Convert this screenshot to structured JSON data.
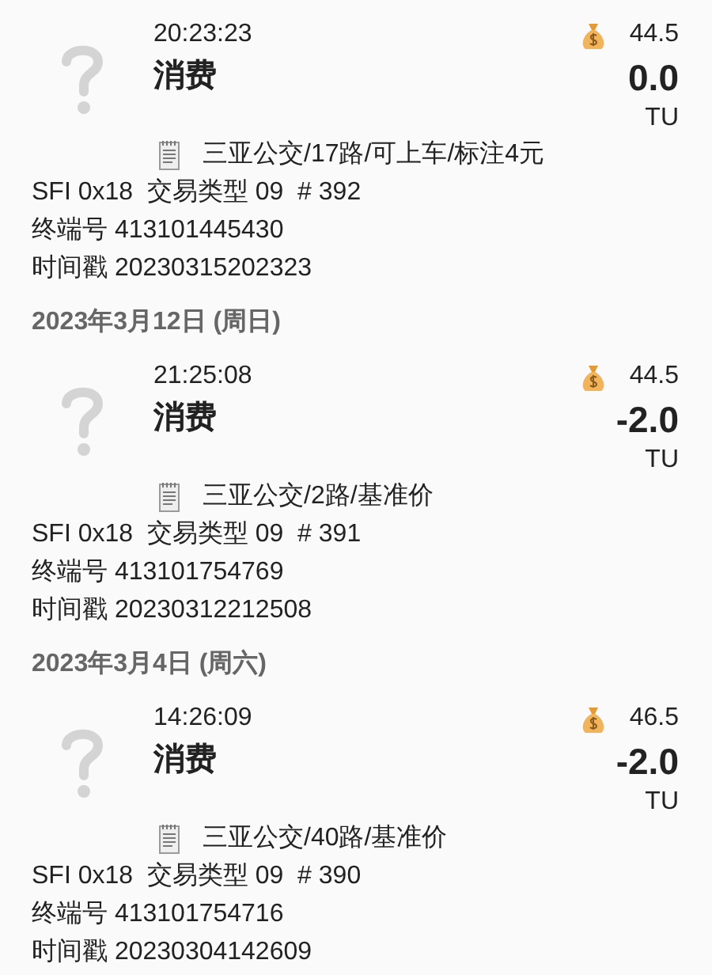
{
  "items": [
    {
      "kind": "transaction",
      "time": "20:23:23",
      "type": "消费",
      "balance": "44.5",
      "amount": "0.0",
      "unit": "TU",
      "memo": "三亚公交/17路/可上车/标注4元",
      "sfi": "SFI 0x18  交易类型 09  # 392",
      "terminal": "终端号 413101445430",
      "timestamp": "时间戳 20230315202323"
    },
    {
      "kind": "header",
      "label": "2023年3月12日 (周日)"
    },
    {
      "kind": "transaction",
      "time": "21:25:08",
      "type": "消费",
      "balance": "44.5",
      "amount": "-2.0",
      "unit": "TU",
      "memo": "三亚公交/2路/基准价",
      "sfi": "SFI 0x18  交易类型 09  # 391",
      "terminal": "终端号 413101754769",
      "timestamp": "时间戳 20230312212508"
    },
    {
      "kind": "header",
      "label": "2023年3月4日 (周六)"
    },
    {
      "kind": "transaction",
      "time": "14:26:09",
      "type": "消费",
      "balance": "46.5",
      "amount": "-2.0",
      "unit": "TU",
      "memo": "三亚公交/40路/基准价",
      "sfi": "SFI 0x18  交易类型 09  # 390",
      "terminal": "终端号 413101754716",
      "timestamp": "时间戳 20230304142609"
    }
  ]
}
